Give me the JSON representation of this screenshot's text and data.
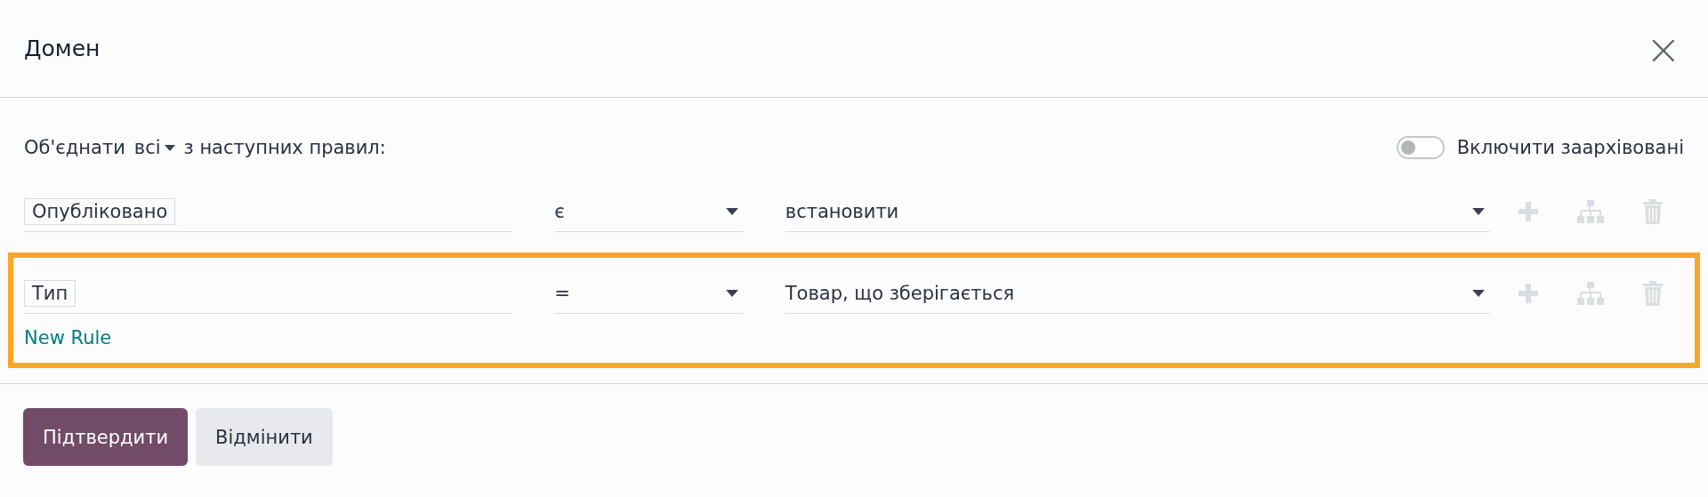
{
  "dialog": {
    "title": "Домен",
    "close": "×"
  },
  "combine": {
    "prefix": "Об'єднати",
    "mode": "всі",
    "suffix": "з наступних правил:"
  },
  "archived_toggle": {
    "label": "Включити заархівовані",
    "on": false
  },
  "sections": [
    {
      "highlighted": false,
      "rules": [
        {
          "field": "Опубліковано",
          "operator": "є",
          "value": "встановити"
        }
      ]
    },
    {
      "highlighted": true,
      "rules": [
        {
          "field": "Тип",
          "operator": "=",
          "value": "Товар, що зберігається"
        }
      ],
      "new_rule": "New Rule"
    }
  ],
  "buttons": [
    {
      "label": "Підтвердити",
      "kind": "primary"
    },
    {
      "label": "Відмінити",
      "kind": "secondary"
    }
  ]
}
